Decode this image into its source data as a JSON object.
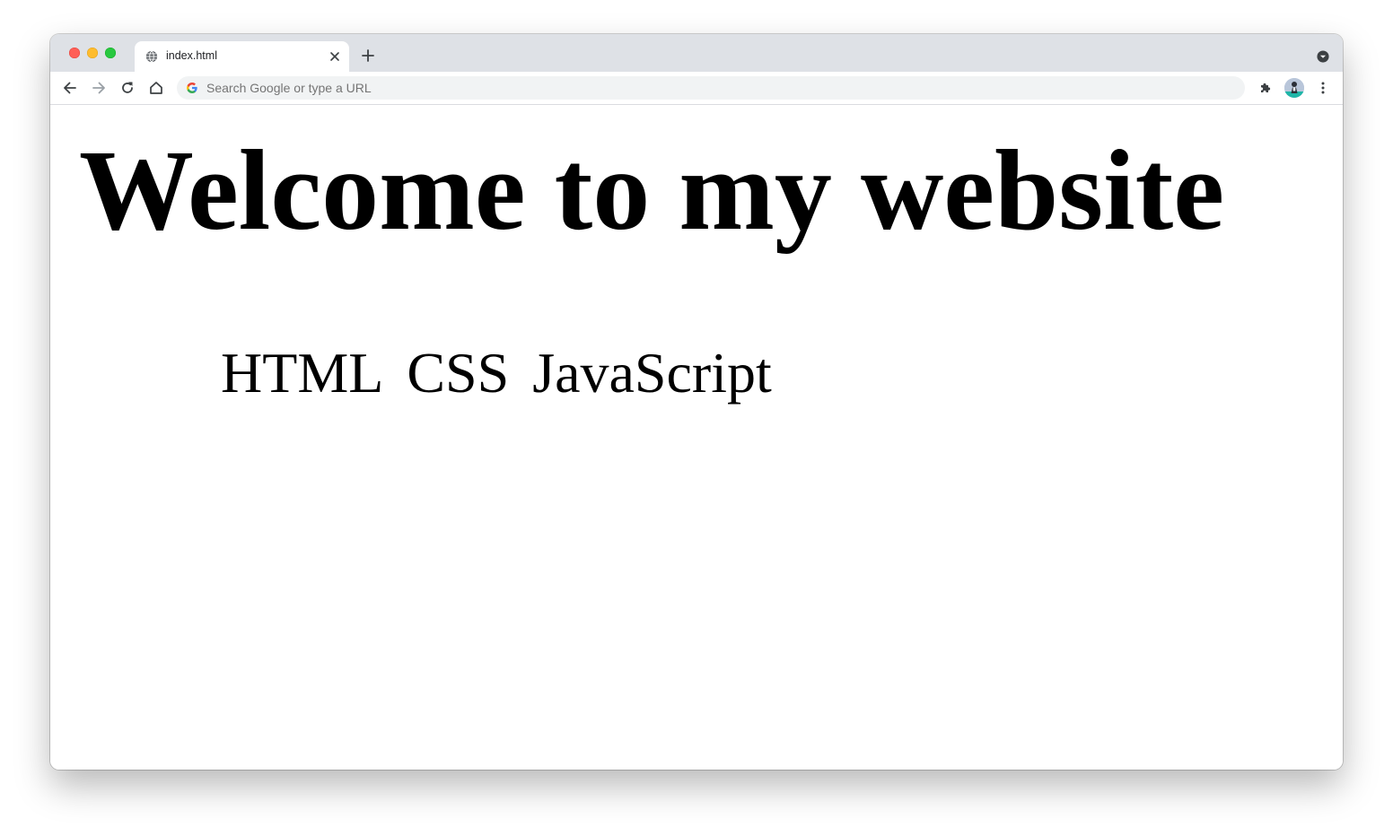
{
  "browser": {
    "tab": {
      "title": "index.html"
    },
    "omnibox": {
      "placeholder": "Search Google or type a URL"
    }
  },
  "icons": {
    "favicon": "globe-icon",
    "close": "close-icon",
    "new_tab": "plus-icon",
    "tab_search": "chevron-down-circle-icon",
    "back": "arrow-left-icon",
    "forward": "arrow-right-icon",
    "reload": "reload-icon",
    "home": "home-icon",
    "search_engine": "google-g-icon",
    "extensions": "puzzle-icon",
    "profile": "avatar",
    "menu": "kebab-menu-icon"
  },
  "colors": {
    "titlebar": "#dee1e6",
    "omnibox_bg": "#f1f3f4",
    "traffic_red": "#fe5f57",
    "traffic_yellow": "#febc2e",
    "traffic_green": "#28c840"
  },
  "page": {
    "heading": "Welcome to my website",
    "items": [
      "HTML",
      "CSS",
      "JavaScript"
    ]
  }
}
